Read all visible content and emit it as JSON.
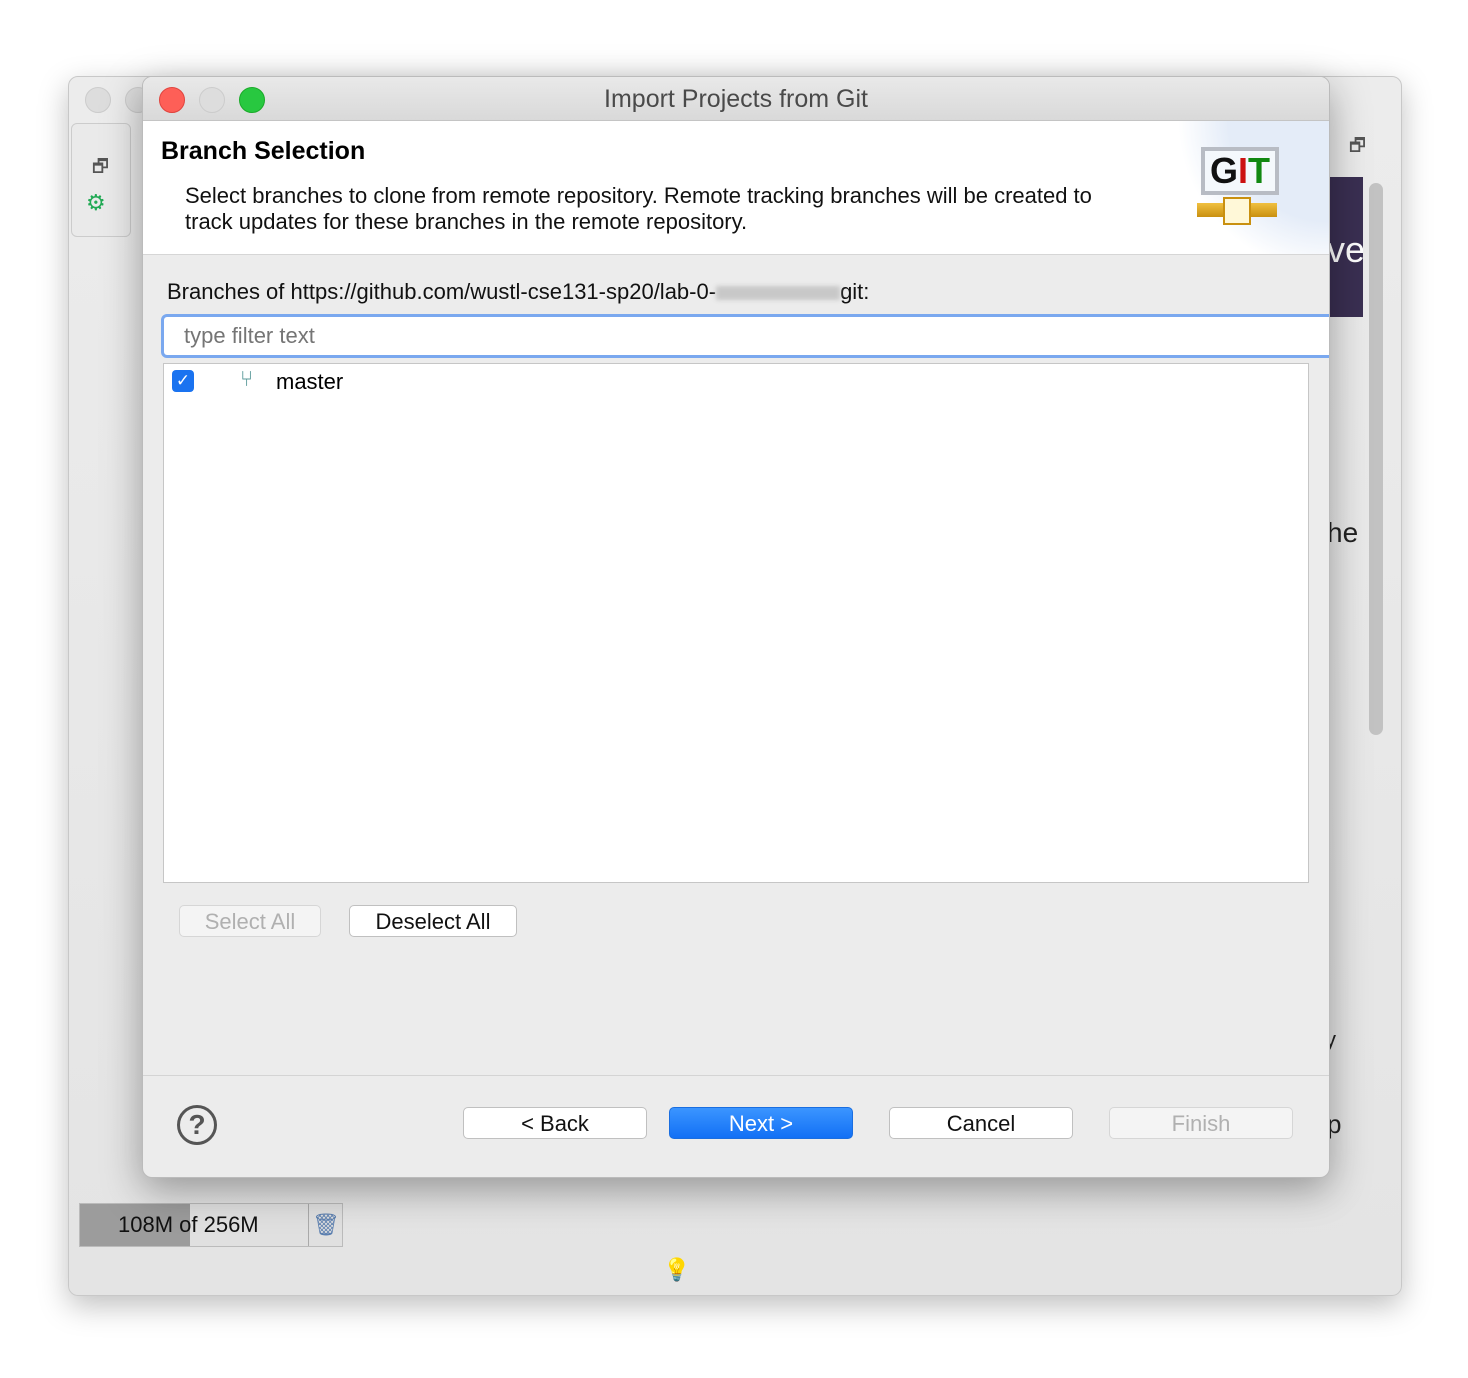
{
  "background_window": {
    "fragments": [
      "ve",
      "he",
      "y",
      "p"
    ],
    "memory": {
      "label": "108M of 256M",
      "used_mb": 108,
      "total_mb": 256
    }
  },
  "dialog": {
    "title": "Import Projects from Git",
    "header": {
      "title": "Branch Selection",
      "description_line1": "Select branches to clone from remote repository. Remote tracking branches will be created to",
      "description_line2": "track updates for these branches in the remote repository.",
      "logo_text": "GIT"
    },
    "branches_label_prefix": "Branches of https://github.com/wustl-cse131-sp20/lab-0-",
    "branches_label_suffix": "git:",
    "filter": {
      "placeholder": "type filter text",
      "value": ""
    },
    "branches": [
      {
        "name": "master",
        "checked": true
      }
    ],
    "select_all": "Select All",
    "deselect_all": "Deselect All",
    "buttons": {
      "back": "< Back",
      "next": "Next >",
      "cancel": "Cancel",
      "finish": "Finish"
    },
    "accent": "#1a73f0"
  }
}
